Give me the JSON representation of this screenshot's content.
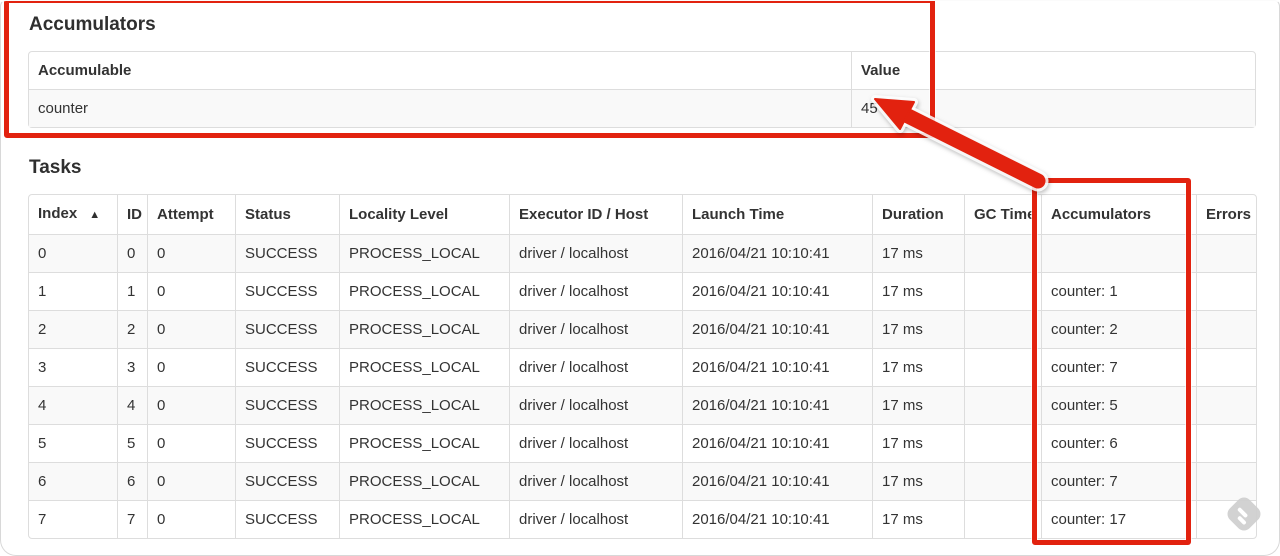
{
  "accumulators_section": {
    "heading": "Accumulators",
    "table": {
      "headers": [
        "Accumulable",
        "Value"
      ],
      "rows": [
        [
          "counter",
          "45"
        ]
      ]
    }
  },
  "tasks_section": {
    "heading": "Tasks",
    "table": {
      "headers": [
        "Index",
        "ID",
        "Attempt",
        "Status",
        "Locality Level",
        "Executor ID / Host",
        "Launch Time",
        "Duration",
        "GC Time",
        "Accumulators",
        "Errors"
      ],
      "sort": {
        "column": "Index",
        "glyph": "▲",
        "direction": "ascending"
      },
      "rows": [
        [
          "0",
          "0",
          "0",
          "SUCCESS",
          "PROCESS_LOCAL",
          "driver / localhost",
          "2016/04/21 10:10:41",
          "17 ms",
          "",
          "",
          ""
        ],
        [
          "1",
          "1",
          "0",
          "SUCCESS",
          "PROCESS_LOCAL",
          "driver / localhost",
          "2016/04/21 10:10:41",
          "17 ms",
          "",
          "counter: 1",
          ""
        ],
        [
          "2",
          "2",
          "0",
          "SUCCESS",
          "PROCESS_LOCAL",
          "driver / localhost",
          "2016/04/21 10:10:41",
          "17 ms",
          "",
          "counter: 2",
          ""
        ],
        [
          "3",
          "3",
          "0",
          "SUCCESS",
          "PROCESS_LOCAL",
          "driver / localhost",
          "2016/04/21 10:10:41",
          "17 ms",
          "",
          "counter: 7",
          ""
        ],
        [
          "4",
          "4",
          "0",
          "SUCCESS",
          "PROCESS_LOCAL",
          "driver / localhost",
          "2016/04/21 10:10:41",
          "17 ms",
          "",
          "counter: 5",
          ""
        ],
        [
          "5",
          "5",
          "0",
          "SUCCESS",
          "PROCESS_LOCAL",
          "driver / localhost",
          "2016/04/21 10:10:41",
          "17 ms",
          "",
          "counter: 6",
          ""
        ],
        [
          "6",
          "6",
          "0",
          "SUCCESS",
          "PROCESS_LOCAL",
          "driver / localhost",
          "2016/04/21 10:10:41",
          "17 ms",
          "",
          "counter: 7",
          ""
        ],
        [
          "7",
          "7",
          "0",
          "SUCCESS",
          "PROCESS_LOCAL",
          "driver / localhost",
          "2016/04/21 10:10:41",
          "17 ms",
          "",
          "counter: 17",
          ""
        ]
      ]
    }
  },
  "annotations": {
    "color": "#e2220f",
    "highlights": [
      "accumulators-summary-box",
      "tasks-accumulators-column-box",
      "arrow-to-value-45"
    ]
  },
  "watermark": {
    "icon": "feedly-logo",
    "color": "#cfcfcf"
  }
}
